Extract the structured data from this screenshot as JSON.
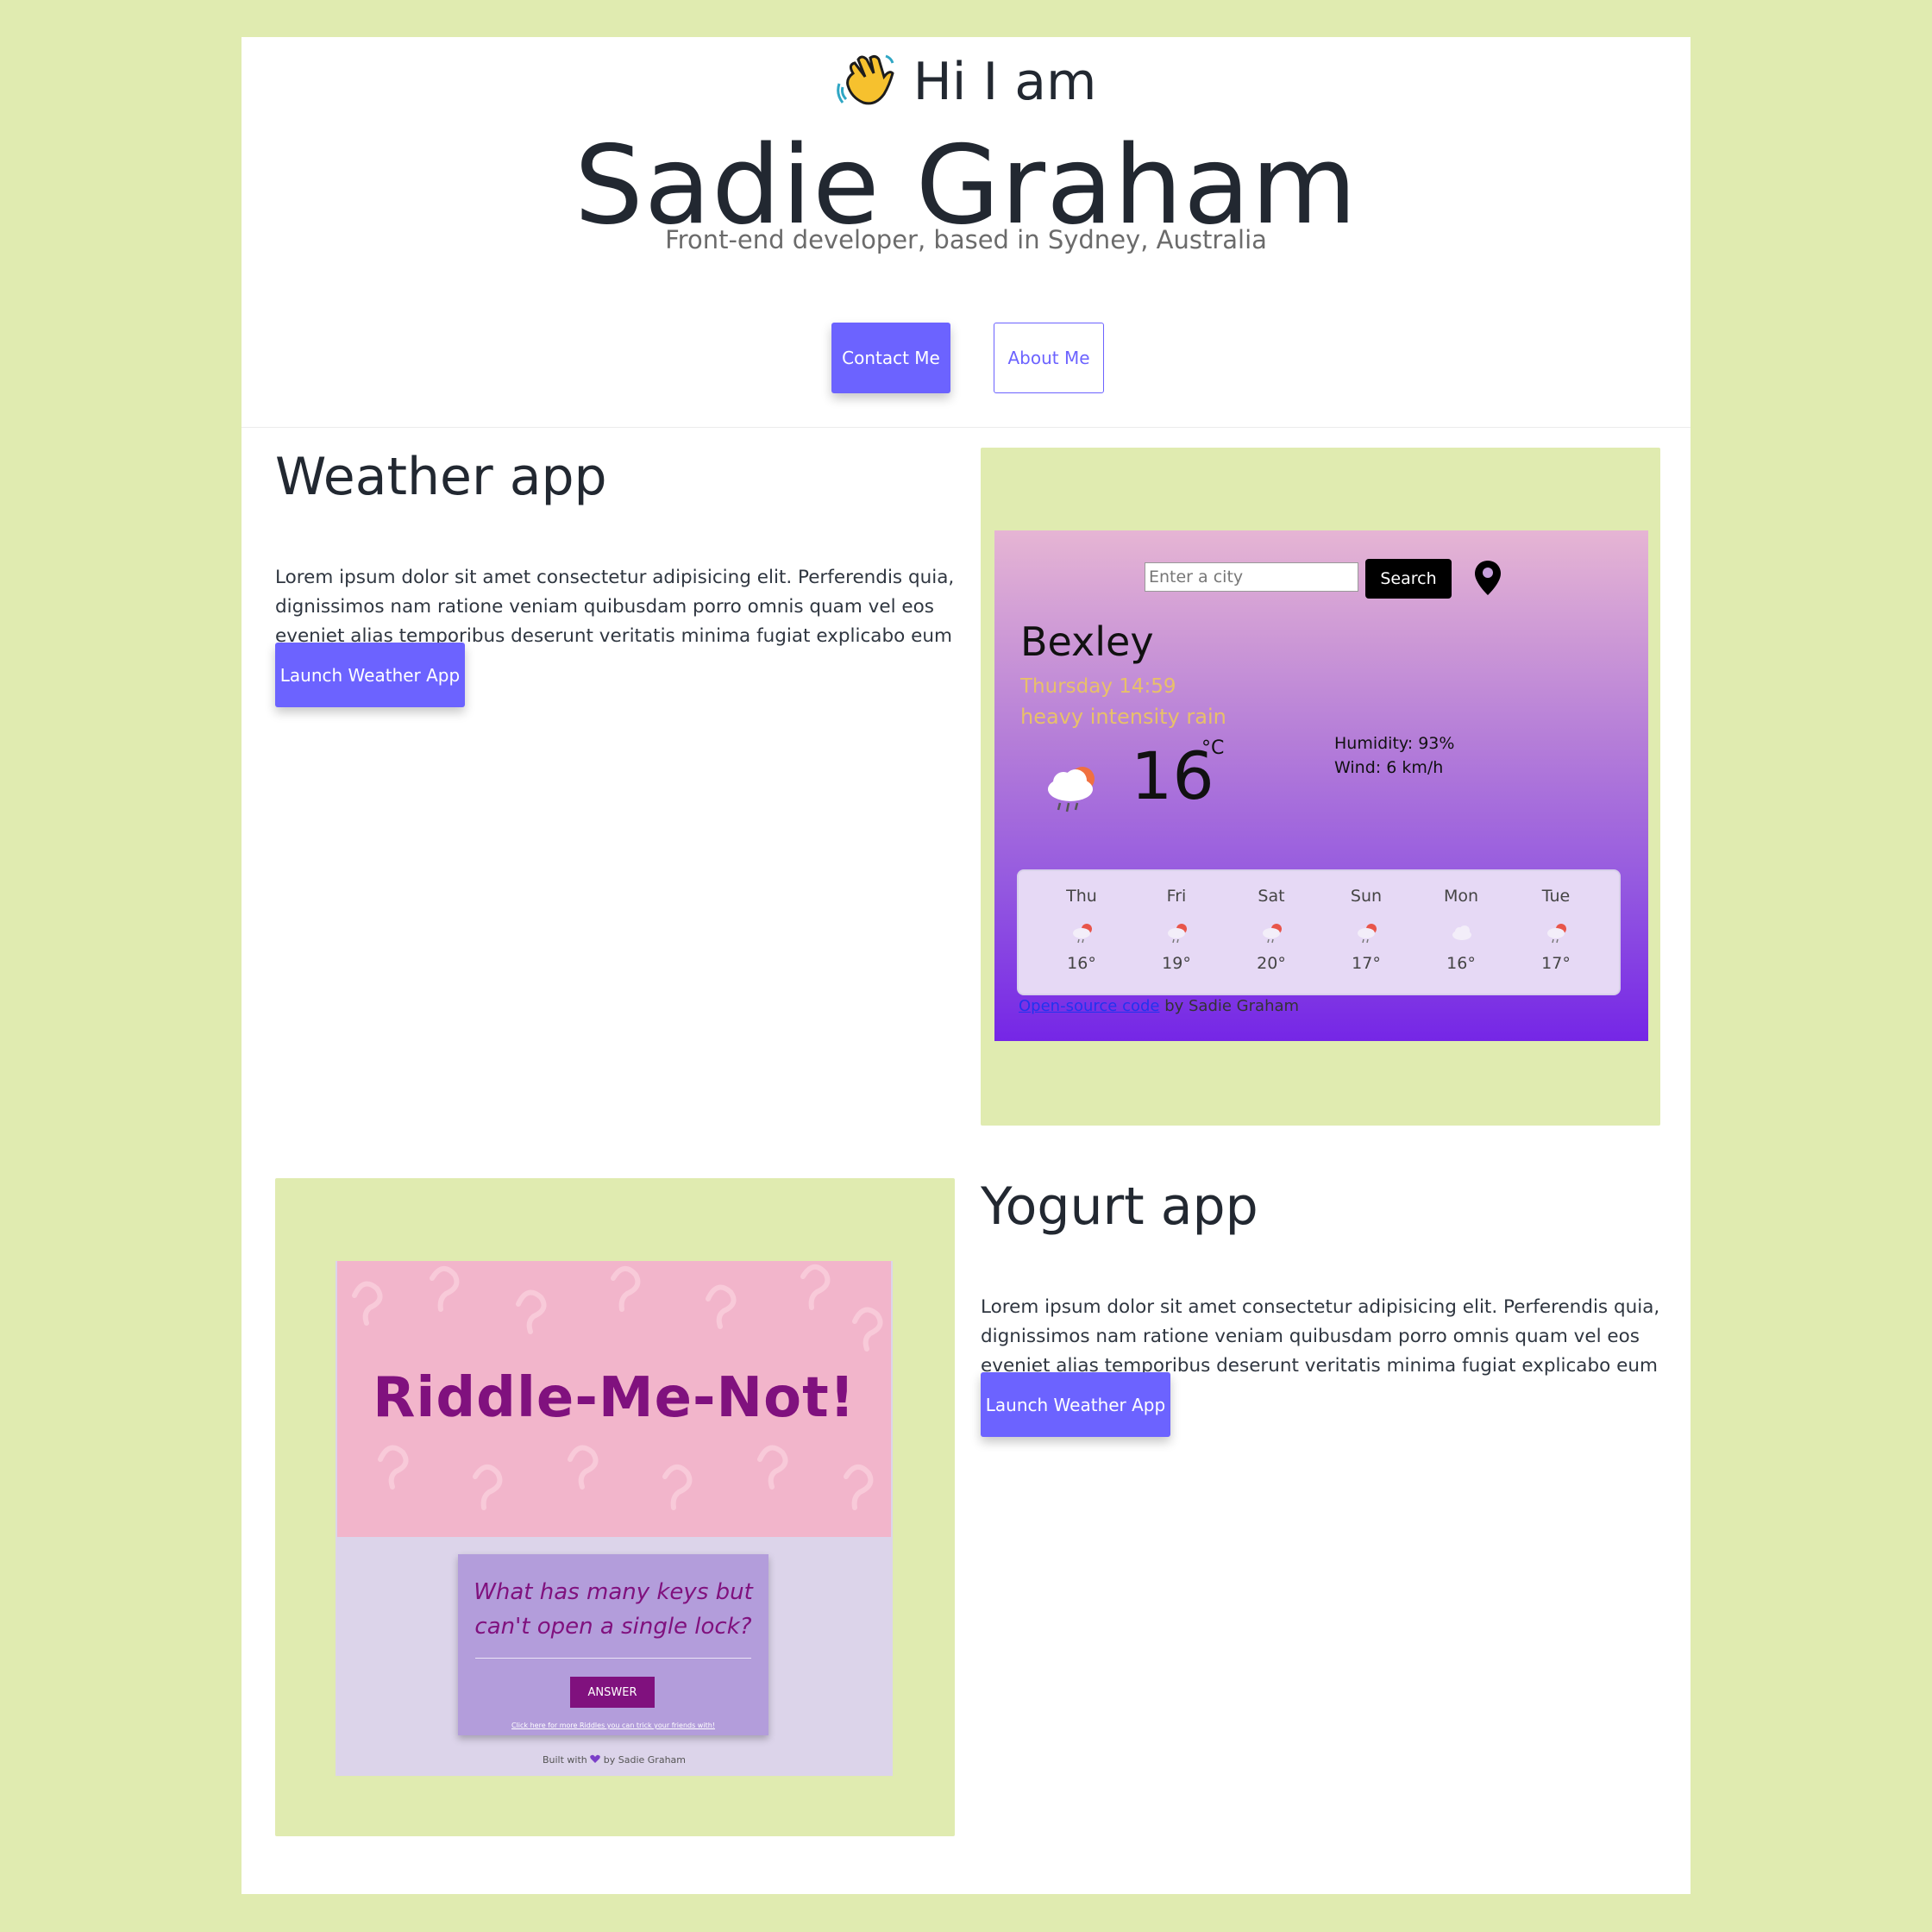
{
  "hero": {
    "greeting": "Hi I am",
    "wave_icon": "waving-hand-icon",
    "name": "Sadie Graham",
    "tagline": "Front-end developer, based in Sydney, Australia",
    "contact_label": "Contact Me",
    "about_label": "About Me"
  },
  "weather_section": {
    "title": "Weather app",
    "text": "Lorem ipsum dolor sit amet consectetur adipisicing elit. Perferendis quia, dignissimos nam ratione veniam quibusdam porro omnis quam vel eos eveniet alias temporibus deserunt veritatis minima fugiat explicabo eum dolore.",
    "button_label": "Launch Weather App",
    "preview": {
      "input_placeholder": "Enter a city",
      "search_label": "Search",
      "city": "Bexley",
      "datetime": "Thursday 14:59",
      "description": "heavy intensity rain",
      "temperature": "16",
      "unit": "°C",
      "humidity": "Humidity: 93%",
      "wind": "Wind: 6 km/h",
      "forecast": [
        {
          "day": "Thu",
          "temp": "16°",
          "icon": "rain-icon"
        },
        {
          "day": "Fri",
          "temp": "19°",
          "icon": "rain-icon"
        },
        {
          "day": "Sat",
          "temp": "20°",
          "icon": "rain-icon"
        },
        {
          "day": "Sun",
          "temp": "17°",
          "icon": "rain-icon"
        },
        {
          "day": "Mon",
          "temp": "16°",
          "icon": "cloud-icon"
        },
        {
          "day": "Tue",
          "temp": "17°",
          "icon": "rain-icon"
        }
      ],
      "footer_link": "Open-source code",
      "footer_text": " by Sadie Graham"
    }
  },
  "yogurt_section": {
    "title": "Yogurt app",
    "text": "Lorem ipsum dolor sit amet consectetur adipisicing elit. Perferendis quia, dignissimos nam ratione veniam quibusdam porro omnis quam vel eos eveniet alias temporibus deserunt veritatis minima fugiat explicabo eum dolore.",
    "button_label": "Launch Weather App",
    "preview": {
      "title": "Riddle-Me-Not!",
      "question": "What has many keys but can't open a single lock?",
      "answer_label": "ANSWER",
      "more_link": "Click here for more Riddles you can trick your friends with!",
      "footer_before": "Built with ",
      "footer_after": " by Sadie Graham"
    }
  },
  "colors": {
    "accent": "#6c63ff",
    "background": "#e0ebb0",
    "riddle_purple": "#80117e"
  }
}
